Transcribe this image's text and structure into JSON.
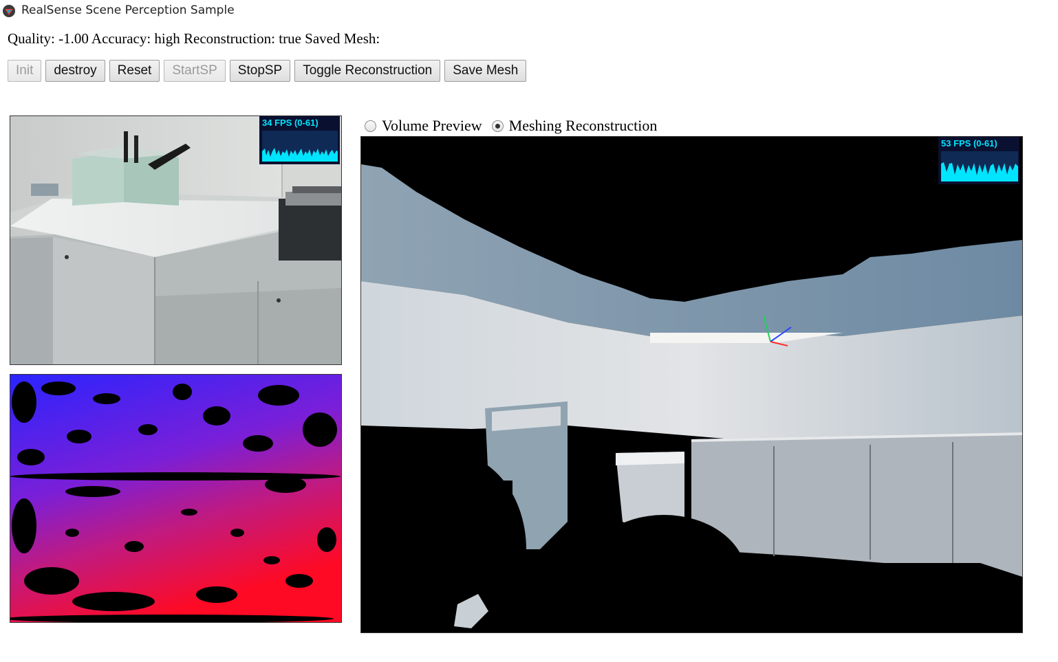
{
  "window": {
    "title": "RealSense Scene Perception Sample",
    "icon": "realsense-app-icon"
  },
  "status": {
    "text": "Quality: -1.00 Accuracy: high Reconstruction: true Saved Mesh:"
  },
  "toolbar": {
    "buttons": [
      {
        "label": "Init",
        "enabled": false
      },
      {
        "label": "destroy",
        "enabled": true
      },
      {
        "label": "Reset",
        "enabled": true
      },
      {
        "label": "StartSP",
        "enabled": false
      },
      {
        "label": "StopSP",
        "enabled": true
      },
      {
        "label": "Toggle Reconstruction",
        "enabled": true
      },
      {
        "label": "Save Mesh",
        "enabled": true
      }
    ]
  },
  "view_mode": {
    "options": [
      {
        "label": "Volume Preview",
        "selected": false
      },
      {
        "label": "Meshing Reconstruction",
        "selected": true
      }
    ]
  },
  "color_view": {
    "fps_label": "34 FPS (0-61)"
  },
  "depth_view": {},
  "reconstruction_view": {
    "fps_label": "53 FPS (0-61)"
  },
  "colors": {
    "fps_text": "#00e5ff",
    "fps_bg": "#0a1030",
    "depth_near": "#ff0020",
    "depth_far": "#2020ff"
  }
}
